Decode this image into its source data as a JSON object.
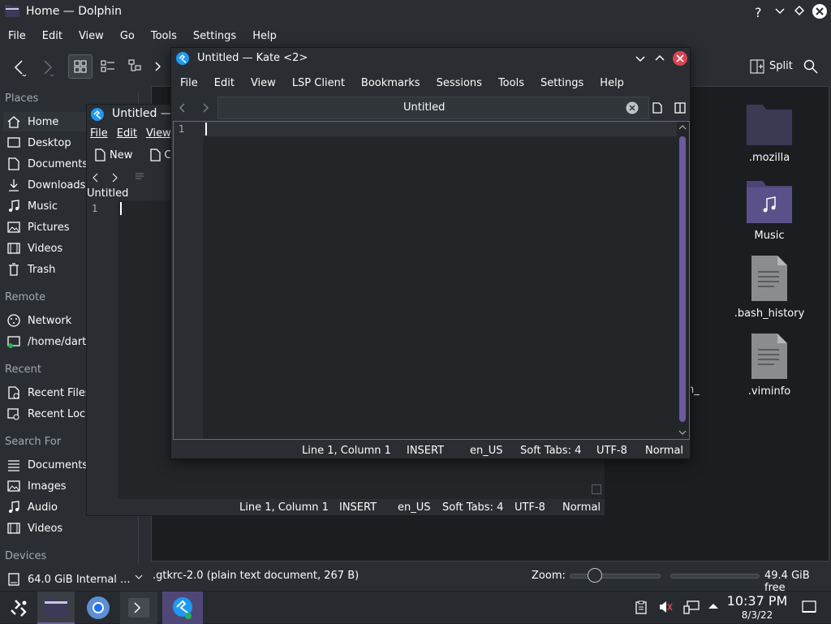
{
  "dolphin": {
    "title": "Home — Dolphin",
    "menu": [
      "File",
      "Edit",
      "View",
      "Go",
      "Tools",
      "Settings",
      "Help"
    ],
    "split_label": "Split",
    "places_header": "Places",
    "places": [
      "Home",
      "Desktop",
      "Documents",
      "Downloads",
      "Music",
      "Pictures",
      "Videos",
      "Trash"
    ],
    "remote_header": "Remote",
    "remote": [
      "Network",
      "/home/dartz"
    ],
    "recent_header": "Recent",
    "recent": [
      "Recent Files",
      "Recent Locations"
    ],
    "searchfor_header": "Search For",
    "searchfor": [
      "Documents",
      "Images",
      "Audio",
      "Videos"
    ],
    "devices_header": "Devices",
    "devices": [
      "64.0 GiB Internal ..."
    ],
    "files": [
      ".mozilla",
      "Music",
      ".bash_history",
      ".viminfo"
    ],
    "partial_file": "h_",
    "status_text": ".gtkrc-2.0 (plain text document, 267 B)",
    "zoom_label": "Zoom:",
    "free_space": "49.4 GiB free"
  },
  "kate_back": {
    "title": "Untitled — K",
    "menu": [
      "File",
      "Edit",
      "View"
    ],
    "toolbar_new": "New",
    "toolbar_partial": "C",
    "tab_title": "Untitled",
    "line_number": "1",
    "status": {
      "position": "Line 1, Column 1",
      "mode": "INSERT",
      "lang": "en_US",
      "tabs": "Soft Tabs: 4",
      "encoding": "UTF-8",
      "input": "Normal"
    }
  },
  "kate": {
    "title": "Untitled — Kate <2>",
    "menu": [
      "File",
      "Edit",
      "View",
      "LSP Client",
      "Bookmarks",
      "Sessions",
      "Tools",
      "Settings",
      "Help"
    ],
    "tab_title": "Untitled",
    "line_number": "1",
    "status": {
      "position": "Line 1, Column 1",
      "mode": "INSERT",
      "lang": "en_US",
      "tabs": "Soft Tabs: 4",
      "encoding": "UTF-8",
      "input": "Normal"
    }
  },
  "taskbar": {
    "time": "10:37 PM",
    "date": "8/3/22"
  },
  "colors": {
    "accent": "#6b5aa0",
    "close": "#da4453",
    "folder": "#3b3a55"
  }
}
